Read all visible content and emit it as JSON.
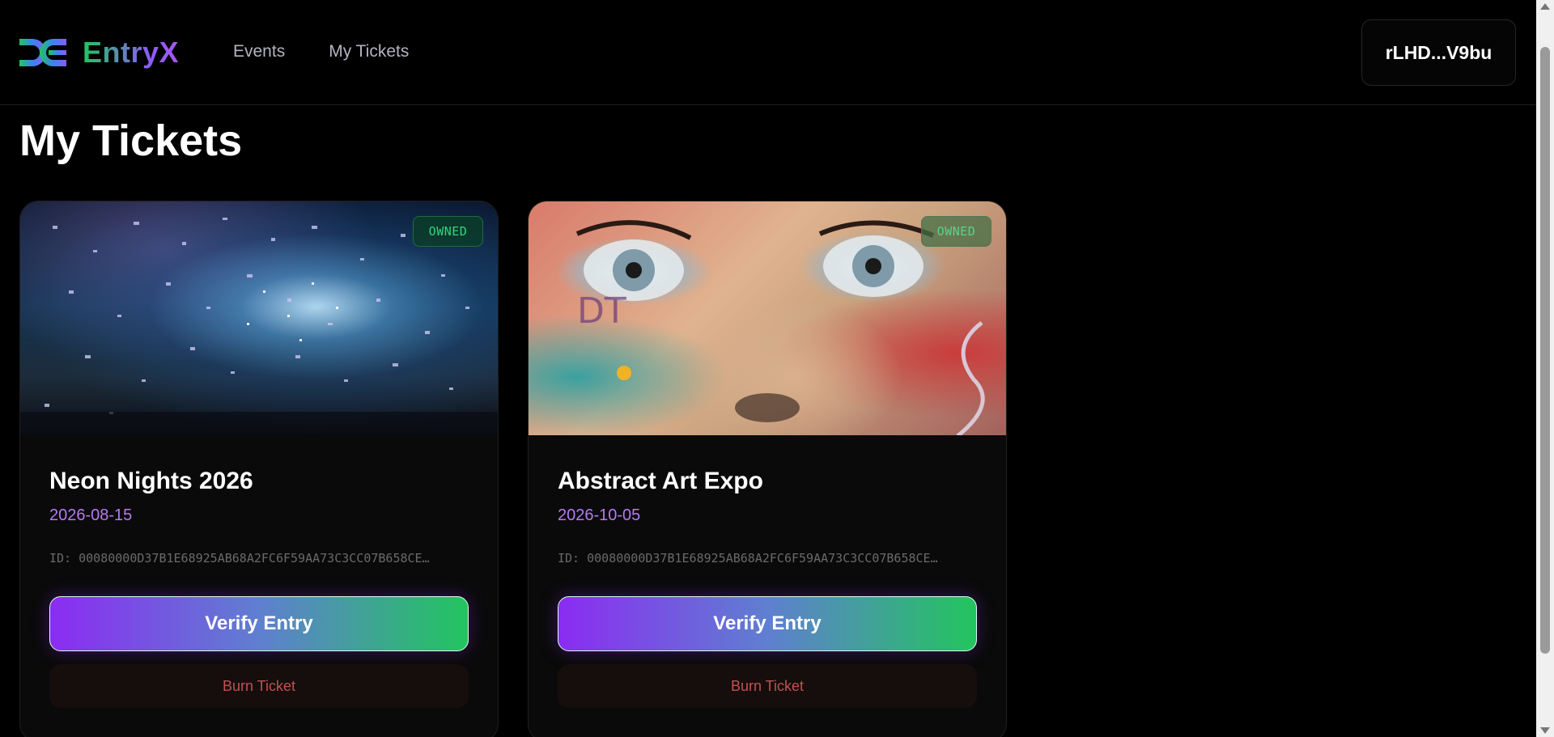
{
  "brand": {
    "name": "EntryX"
  },
  "nav": {
    "items": [
      {
        "label": "Events"
      },
      {
        "label": "My Tickets"
      }
    ]
  },
  "wallet": {
    "address": "rLHD...V9bu"
  },
  "page": {
    "title": "My Tickets"
  },
  "tickets": [
    {
      "badge": "OWNED",
      "title": "Neon Nights 2026",
      "date": "2026-08-15",
      "id_text": "ID: 00080000D37B1E68925AB68A2FC6F59AA73C3CC07B658CE…",
      "verify_label": "Verify Entry",
      "burn_label": "Burn Ticket",
      "image": "confetti-concert-photo"
    },
    {
      "badge": "OWNED",
      "title": "Abstract Art Expo",
      "date": "2026-10-05",
      "id_text": "ID: 00080000D37B1E68925AB68A2FC6F59AA73C3CC07B658CE…",
      "verify_label": "Verify Entry",
      "burn_label": "Burn Ticket",
      "image": "street-art-face-mural"
    }
  ],
  "colors": {
    "accent_purple": "#8b2cf2",
    "accent_green": "#22c55e",
    "date_purple": "#b77af0",
    "burn_red": "#c0524f",
    "owned_green": "#34d37c"
  }
}
